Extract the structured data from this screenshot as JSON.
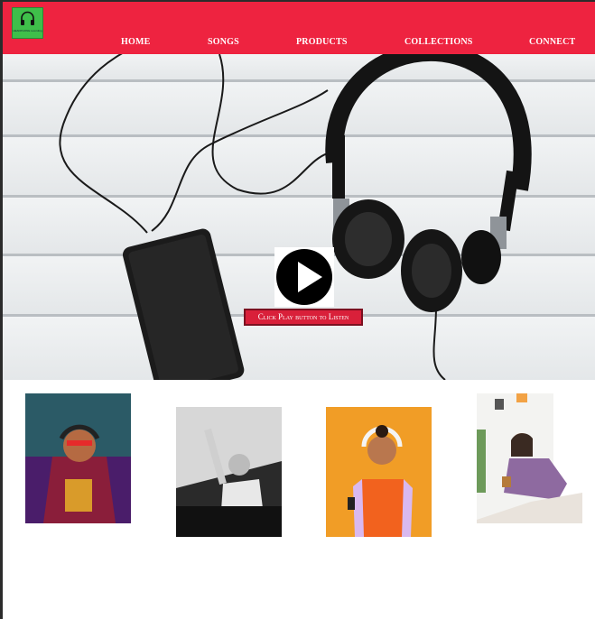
{
  "logo": {
    "text": "HEADPHONE recording",
    "icon": "headphones-icon"
  },
  "nav": {
    "items": [
      {
        "label": "HOME"
      },
      {
        "label": "SONGS"
      },
      {
        "label": "PRODUCTS"
      },
      {
        "label": "COLLECTIONS"
      },
      {
        "label": "CONNECT"
      }
    ]
  },
  "hero": {
    "play_button_label": "Click Play button to Listen",
    "play_icon": "play-icon"
  },
  "gallery": {
    "images": [
      {
        "subject": "artist-with-headphones-photo"
      },
      {
        "subject": "dj-performing-photo"
      },
      {
        "subject": "woman-with-headphones-photo"
      },
      {
        "subject": "woman-relaxing-photo"
      }
    ]
  },
  "colors": {
    "brand": "#ee2340",
    "logo_green": "#3fbf4a"
  }
}
